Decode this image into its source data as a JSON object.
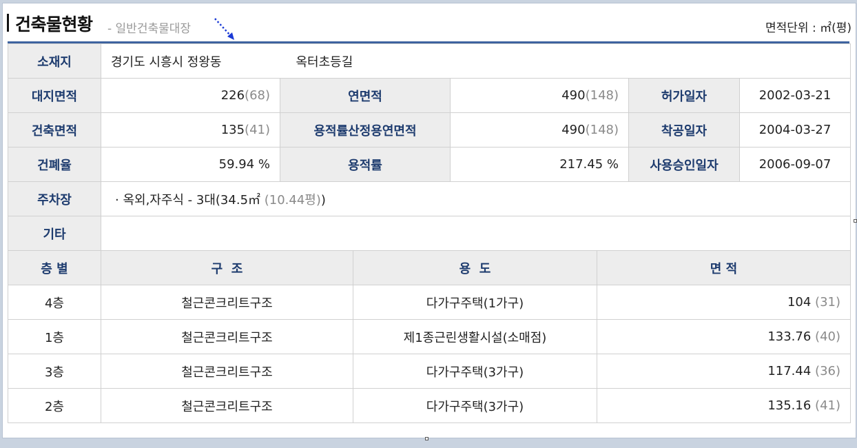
{
  "header": {
    "title": "건축물현황",
    "subtitle": "- 일반건축물대장",
    "unit_label": "면적단위 : ㎡(평)"
  },
  "location": {
    "label": "소재지",
    "address": "경기도 시흥시 정왕동",
    "road": "옥터초등길"
  },
  "info_rows": [
    [
      {
        "label": "대지면적",
        "value": "226",
        "sub": "(68)"
      },
      {
        "label": "연면적",
        "value": "490",
        "sub": "(148)"
      },
      {
        "label": "허가일자",
        "value": "2002-03-21"
      }
    ],
    [
      {
        "label": "건축면적",
        "value": "135",
        "sub": "(41)"
      },
      {
        "label": "용적률산정용연면적",
        "value": "490",
        "sub": "(148)"
      },
      {
        "label": "착공일자",
        "value": "2004-03-27"
      }
    ],
    [
      {
        "label": "건폐율",
        "value": "59.94 %"
      },
      {
        "label": "용적률",
        "value": "217.45 %"
      },
      {
        "label": "사용승인일자",
        "value": "2006-09-07"
      }
    ]
  ],
  "parking": {
    "label": "주차장",
    "value": "· 옥외,자주식 - 3대(34.5㎡",
    "sub": "(10.44평)",
    "close": ")"
  },
  "etc": {
    "label": "기타",
    "value": ""
  },
  "floor_headers": [
    "층 별",
    "구  조",
    "용  도",
    "면 적"
  ],
  "floors": [
    {
      "floor": "4층",
      "structure": "철근콘크리트구조",
      "use": "다가구주택(1가구)",
      "area": "104",
      "pyeong": "(31)"
    },
    {
      "floor": "1층",
      "structure": "철근콘크리트구조",
      "use": "제1종근린생활시설(소매점)",
      "area": "133.76",
      "pyeong": "(40)"
    },
    {
      "floor": "3층",
      "structure": "철근콘크리트구조",
      "use": "다가구주택(3가구)",
      "area": "117.44",
      "pyeong": "(36)"
    },
    {
      "floor": "2층",
      "structure": "철근콘크리트구조",
      "use": "다가구주택(3가구)",
      "area": "135.16",
      "pyeong": "(41)"
    }
  ],
  "colors": {
    "accent": "#3e63a0",
    "header_bg": "#ededed",
    "header_text": "#1d3b6e",
    "muted": "#8a8a8a"
  }
}
